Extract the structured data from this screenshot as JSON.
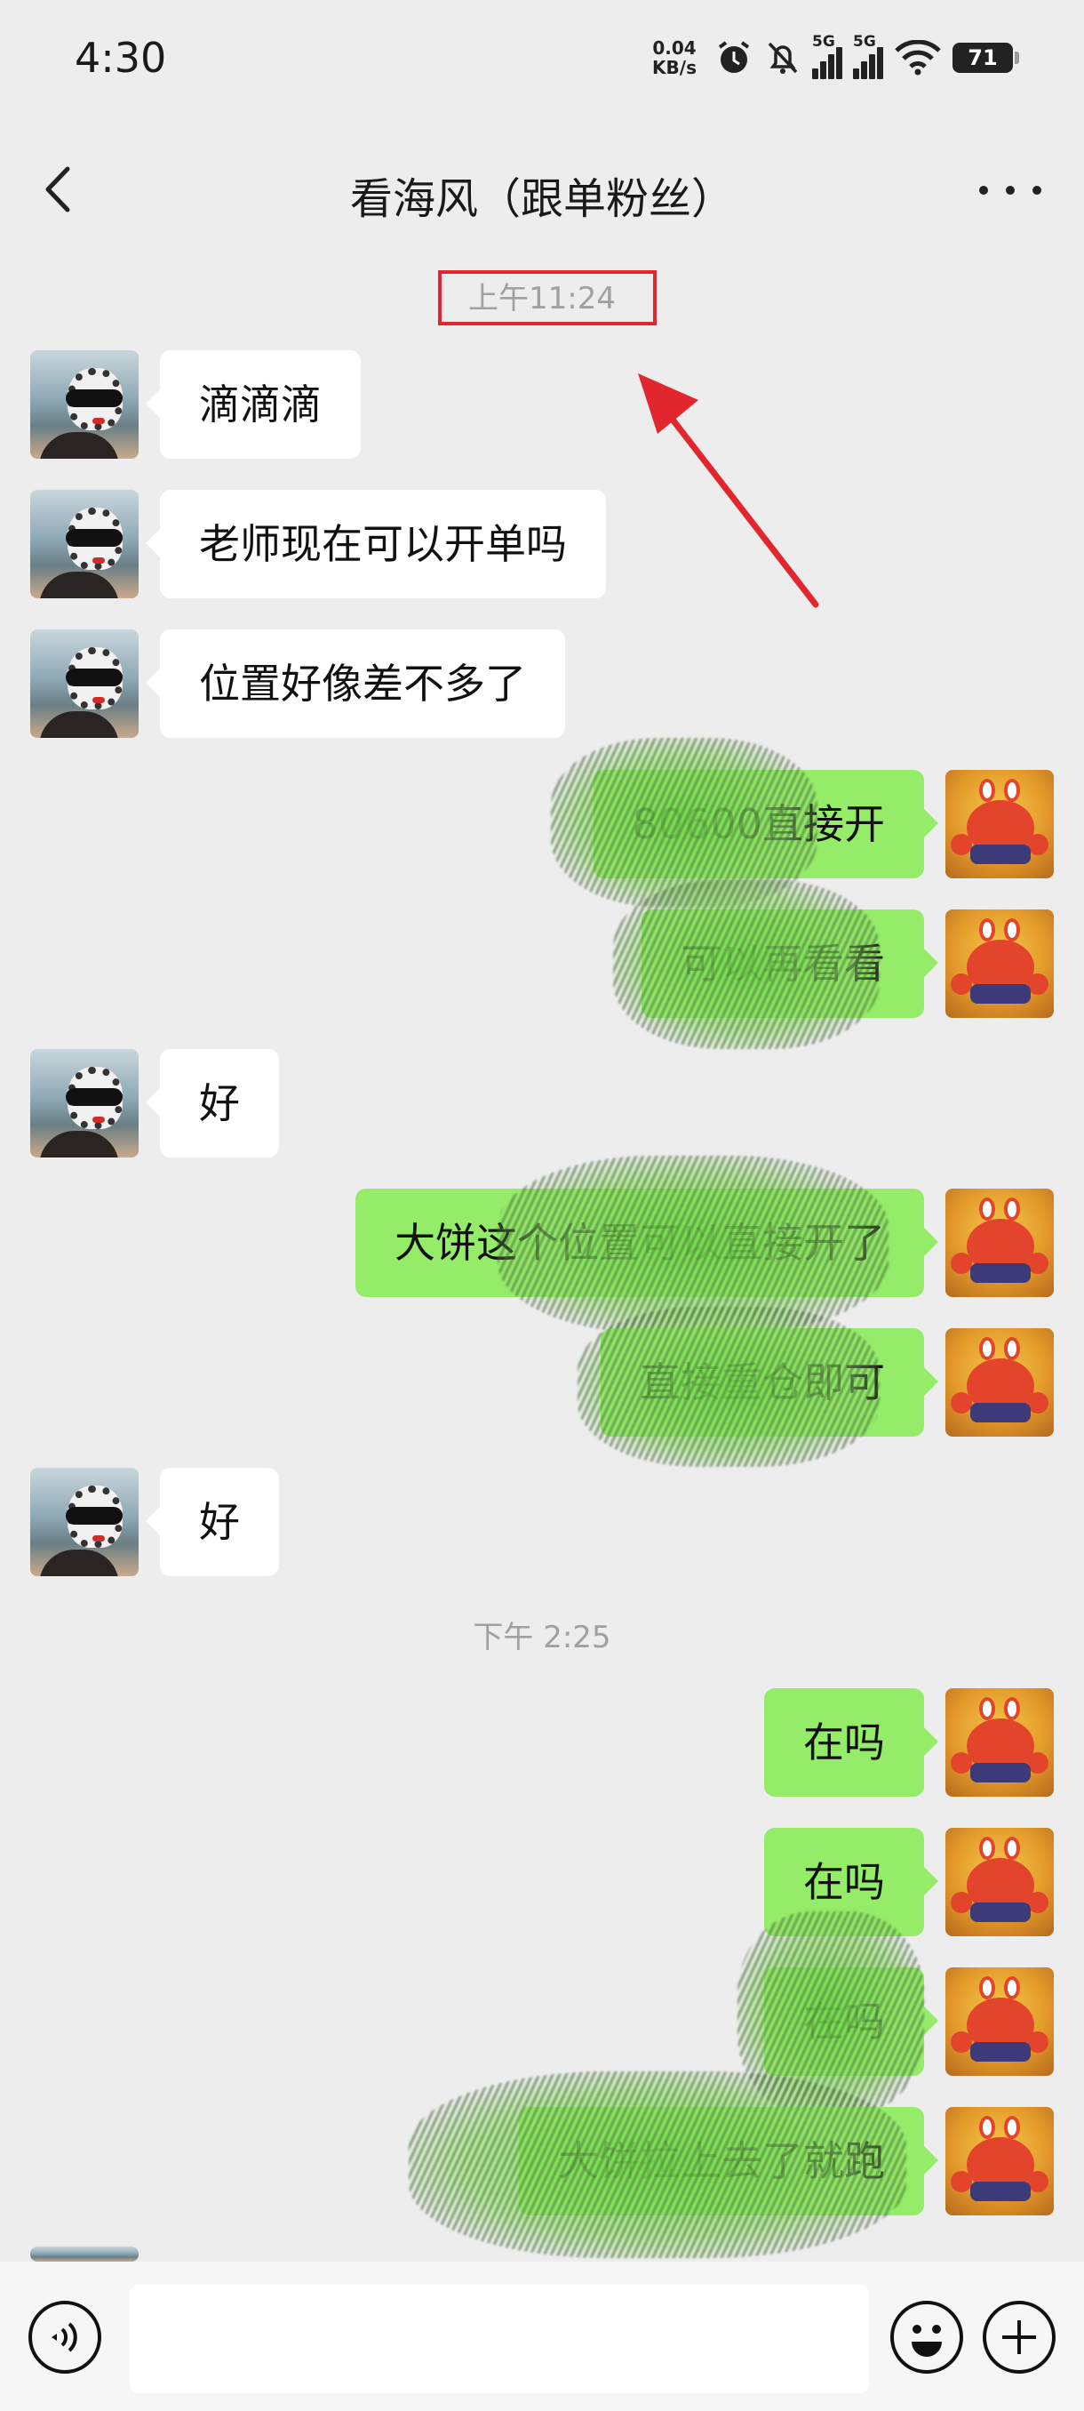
{
  "status_bar": {
    "time": "4:30",
    "net_speed_value": "0.04",
    "net_speed_unit": "KB/s",
    "network_1": "5G",
    "network_2": "5G",
    "battery": "71",
    "icons": [
      "alarm-icon",
      "mute-bell-icon",
      "signal-icon",
      "signal-icon",
      "wifi-icon",
      "battery-icon"
    ]
  },
  "header": {
    "title": "看海风（跟单粉丝）",
    "back_icon": "chevron-left-icon",
    "more_icon": "more-dots-icon"
  },
  "messages": [
    {
      "type": "time",
      "text": "上午11:24",
      "highlighted": true
    },
    {
      "type": "msg",
      "side": "left",
      "text": "滴滴滴"
    },
    {
      "type": "msg",
      "side": "left",
      "text": "老师现在可以开单吗"
    },
    {
      "type": "msg",
      "side": "left",
      "text": "位置好像差不多了"
    },
    {
      "type": "msg",
      "side": "right",
      "text": "80600直接开",
      "scribbled": true
    },
    {
      "type": "msg",
      "side": "right",
      "text": "可以再看看",
      "scribbled": true
    },
    {
      "type": "msg",
      "side": "left",
      "text": "好"
    },
    {
      "type": "msg",
      "side": "right",
      "text": "大饼这个位置可以直接开了",
      "scribbled": true
    },
    {
      "type": "msg",
      "side": "right",
      "text": "直接重仓即可",
      "scribbled": true
    },
    {
      "type": "msg",
      "side": "left",
      "text": "好"
    },
    {
      "type": "time",
      "text": "下午 2:25"
    },
    {
      "type": "msg",
      "side": "right",
      "text": "在吗"
    },
    {
      "type": "msg",
      "side": "right",
      "text": "在吗"
    },
    {
      "type": "msg",
      "side": "right",
      "text": "在吗",
      "scribbled": true
    },
    {
      "type": "msg",
      "side": "right",
      "text": "大饼拉上去了就跑",
      "scribbled": true
    }
  ],
  "input_bar": {
    "placeholder": "",
    "voice_icon": "voice-icon",
    "emoji_icon": "emoji-icon",
    "plus_icon": "plus-icon"
  },
  "annotation": {
    "color": "#e2262e"
  }
}
